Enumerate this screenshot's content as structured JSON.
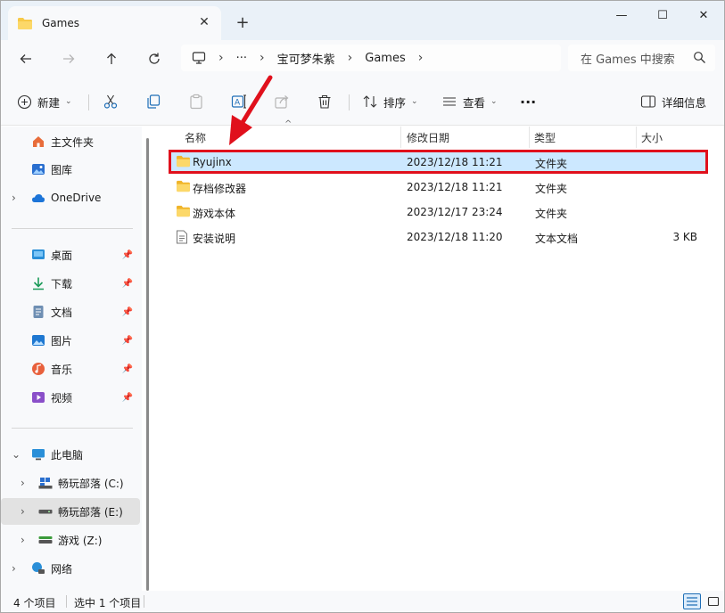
{
  "window": {
    "tab_title": "Games",
    "tab_close": "✕",
    "new_tab": "+",
    "minimize": "—",
    "maximize": "☐",
    "close": "✕"
  },
  "nav": {
    "breadcrumbs": [
      "宝可梦朱紫",
      "Games"
    ],
    "more": "···",
    "search_placeholder": "在 Games 中搜索"
  },
  "toolbar": {
    "new_label": "新建",
    "sort_label": "排序",
    "view_label": "查看",
    "more": "···",
    "details_label": "详细信息"
  },
  "sidebar": {
    "home": "主文件夹",
    "gallery": "图库",
    "onedrive": "OneDrive",
    "quick": [
      {
        "label": "桌面",
        "icon": "desktop-icon"
      },
      {
        "label": "下载",
        "icon": "download-icon"
      },
      {
        "label": "文档",
        "icon": "document-icon"
      },
      {
        "label": "图片",
        "icon": "pictures-icon"
      },
      {
        "label": "音乐",
        "icon": "music-icon"
      },
      {
        "label": "视频",
        "icon": "video-icon"
      }
    ],
    "this_pc": "此电脑",
    "drives": [
      {
        "label": "畅玩部落 (C:)"
      },
      {
        "label": "畅玩部落 (E:)"
      },
      {
        "label": "游戏 (Z:)"
      }
    ],
    "network": "网络"
  },
  "columns": {
    "name": "名称",
    "modified": "修改日期",
    "type": "类型",
    "size": "大小"
  },
  "files": [
    {
      "name": "Ryujinx",
      "modified": "2023/12/18 11:21",
      "type": "文件夹",
      "size": "",
      "icon": "folder-icon"
    },
    {
      "name": "存档修改器",
      "modified": "2023/12/18 11:21",
      "type": "文件夹",
      "size": "",
      "icon": "folder-icon"
    },
    {
      "name": "游戏本体",
      "modified": "2023/12/17 23:24",
      "type": "文件夹",
      "size": "",
      "icon": "folder-icon"
    },
    {
      "name": "安装说明",
      "modified": "2023/12/18 11:20",
      "type": "文本文档",
      "size": "3 KB",
      "icon": "text-file-icon"
    }
  ],
  "status": {
    "item_count": "4 个项目",
    "selected": "选中 1 个项目"
  },
  "colors": {
    "accent": "#0067c0",
    "folder": "#f7c948",
    "highlight": "#e0101c",
    "selection": "#cce8ff"
  }
}
